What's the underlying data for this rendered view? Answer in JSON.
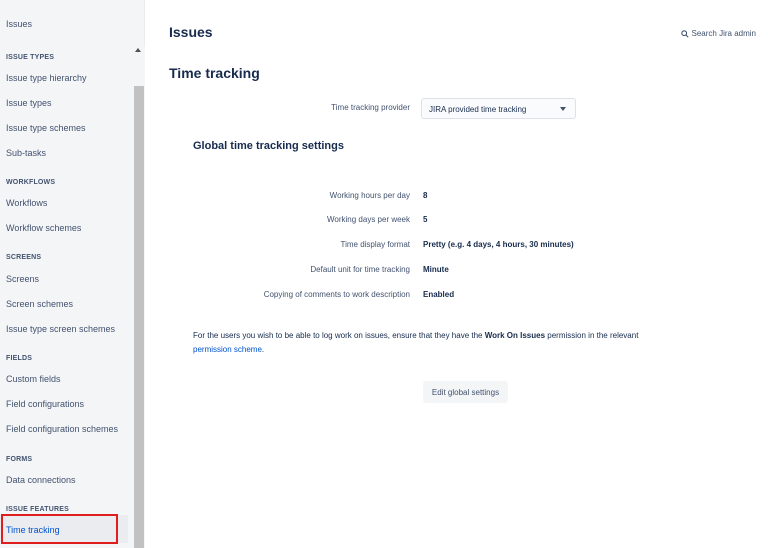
{
  "sidebar": {
    "top_title": "Issues",
    "sections": [
      {
        "title": "ISSUE TYPES",
        "items": [
          "Issue type hierarchy",
          "Issue types",
          "Issue type schemes",
          "Sub-tasks"
        ]
      },
      {
        "title": "WORKFLOWS",
        "items": [
          "Workflows",
          "Workflow schemes"
        ]
      },
      {
        "title": "SCREENS",
        "items": [
          "Screens",
          "Screen schemes",
          "Issue type screen schemes"
        ]
      },
      {
        "title": "FIELDS",
        "items": [
          "Custom fields",
          "Field configurations",
          "Field configuration schemes"
        ]
      },
      {
        "title": "FORMS",
        "items": [
          "Data connections"
        ]
      },
      {
        "title": "ISSUE FEATURES",
        "items": [
          "Time tracking"
        ]
      }
    ],
    "active_item": "Time tracking"
  },
  "header": {
    "title": "Issues",
    "search_label": "Search Jira admin",
    "search_icon": "search-icon"
  },
  "main": {
    "section_title": "Time tracking",
    "provider_label": "Time tracking provider",
    "provider_value": "JIRA provided time tracking",
    "settings_title": "Global time tracking settings",
    "settings": [
      {
        "label": "Working hours per day",
        "value": "8"
      },
      {
        "label": "Working days per week",
        "value": "5"
      },
      {
        "label": "Time display format",
        "value": "Pretty (e.g. 4 days, 4 hours, 30 minutes)"
      },
      {
        "label": "Default unit for time tracking",
        "value": "Minute"
      },
      {
        "label": "Copying of comments to work description",
        "value": "Enabled"
      }
    ],
    "info": {
      "prefix": "For the users you wish to be able to log work on issues, ensure that they have the ",
      "bold": "Work On Issues",
      "middle": " permission in the relevant ",
      "link": "permission scheme",
      "suffix": "."
    },
    "edit_button": "Edit global settings"
  },
  "colors": {
    "accent": "#0052cc",
    "highlight": "#e01e1e",
    "sidebar_bg": "#f4f5f7"
  }
}
